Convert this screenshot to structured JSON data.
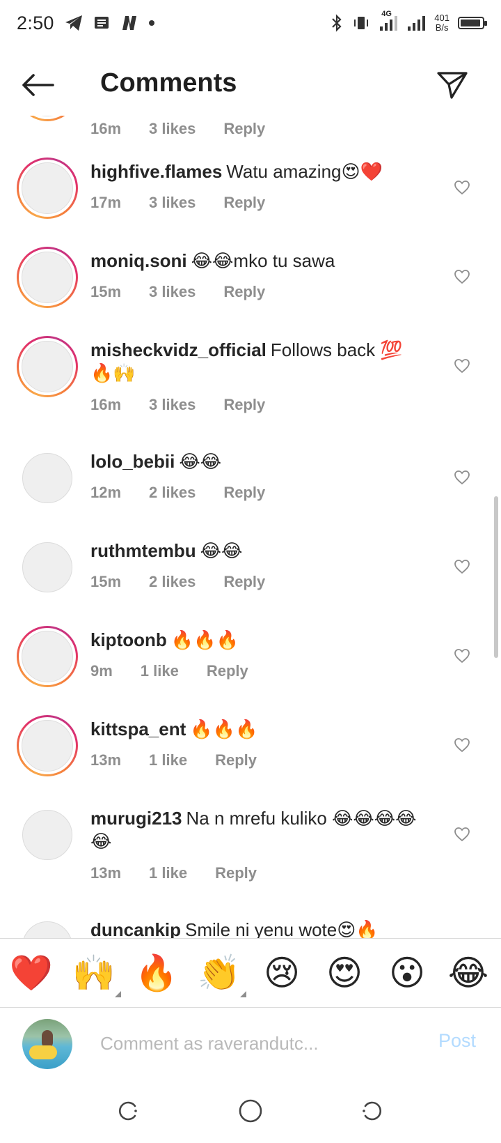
{
  "status_bar": {
    "time": "2:50",
    "network": "4G",
    "speed_value": "401",
    "speed_unit": "B/s"
  },
  "header": {
    "title": "Comments"
  },
  "partial_top": {
    "time": "16m",
    "likes": "3 likes",
    "reply": "Reply"
  },
  "comments": [
    {
      "username": "highfive.flames",
      "text": "Watu amazing😍❤️",
      "time": "17m",
      "likes": "3 likes",
      "reply": "Reply",
      "story_ring": true
    },
    {
      "username": "moniq.soni",
      "text": "😂😂mko tu sawa",
      "time": "15m",
      "likes": "3 likes",
      "reply": "Reply",
      "story_ring": true
    },
    {
      "username": "misheckvidz_official",
      "text": "Follows back 💯 🔥🙌",
      "time": "16m",
      "likes": "3 likes",
      "reply": "Reply",
      "story_ring": true
    },
    {
      "username": "lolo_bebii",
      "text": "😂😂",
      "time": "12m",
      "likes": "2 likes",
      "reply": "Reply",
      "story_ring": false
    },
    {
      "username": "ruthmtembu",
      "text": "😂😂",
      "time": "15m",
      "likes": "2 likes",
      "reply": "Reply",
      "story_ring": false
    },
    {
      "username": "kiptoonb",
      "text": "🔥🔥🔥",
      "time": "9m",
      "likes": "1 like",
      "reply": "Reply",
      "story_ring": true
    },
    {
      "username": "kittspa_ent",
      "text": "🔥🔥🔥",
      "time": "13m",
      "likes": "1 like",
      "reply": "Reply",
      "story_ring": true
    },
    {
      "username": "murugi213",
      "text": "Na n mrefu kuliko 😂😂😂😂😂",
      "time": "13m",
      "likes": "1 like",
      "reply": "Reply",
      "story_ring": false
    },
    {
      "username": "duncankip",
      "text": "Smile ni yenu wote😍🔥",
      "story_ring": false
    }
  ],
  "reactions": [
    "❤️",
    "🙌",
    "🔥",
    "👏",
    "😢",
    "😍",
    "😮",
    "😂"
  ],
  "composer": {
    "placeholder": "Comment as raverandutс...",
    "post_label": "Post"
  },
  "colors": {
    "post_disabled": "#b3dbff",
    "meta_gray": "#8e8e8e"
  }
}
